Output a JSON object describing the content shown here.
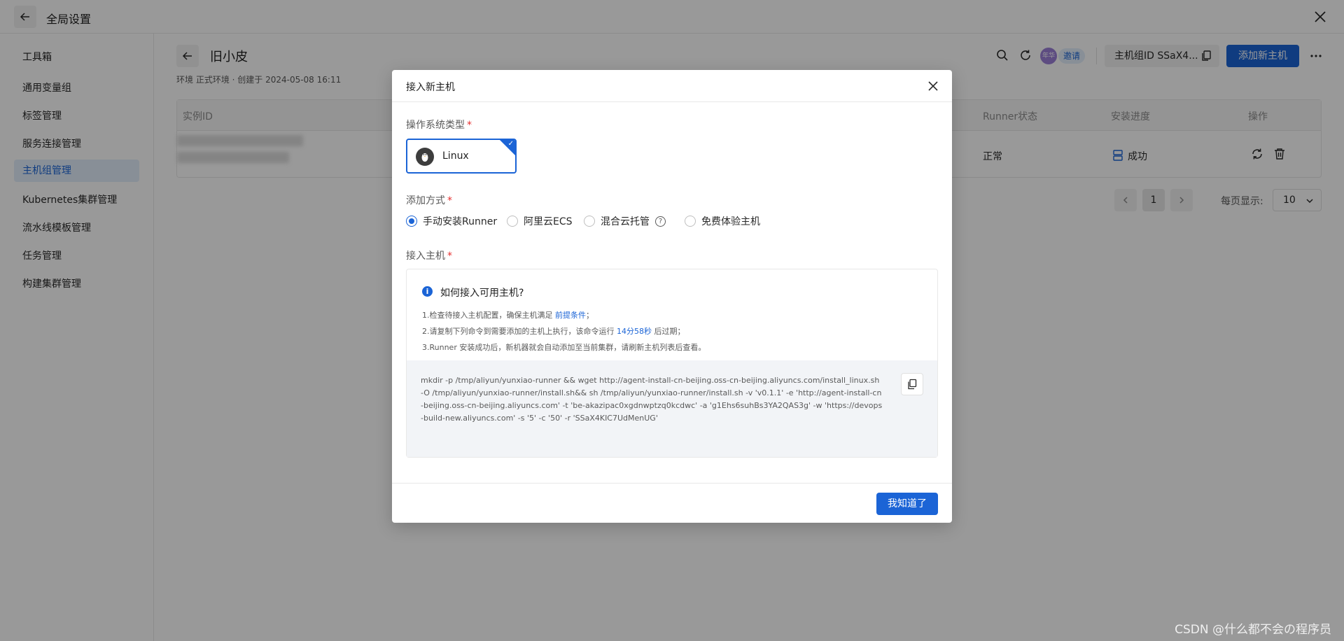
{
  "topbar": {
    "title": "全局设置"
  },
  "sidebar": {
    "heading": "工具箱",
    "items": [
      {
        "label": "通用变量组"
      },
      {
        "label": "标签管理"
      },
      {
        "label": "服务连接管理"
      },
      {
        "label": "主机组管理"
      },
      {
        "label": "Kubernetes集群管理"
      },
      {
        "label": "流水线模板管理"
      },
      {
        "label": "任务管理"
      },
      {
        "label": "构建集群管理"
      }
    ],
    "active_index": 3
  },
  "main": {
    "title": "旧小皮",
    "meta": "环境 正式环境 · 创建于 2024-05-08 16:11",
    "avatar_text": "年华",
    "invite_label": "邀请",
    "group_id_label": "主机组ID SSaX4...",
    "add_host_label": "添加新主机",
    "table": {
      "columns": [
        "实例ID",
        "Runner状态",
        "安装进度",
        "操作"
      ],
      "rows": [
        {
          "runner_status": "正常",
          "install_progress": "成功"
        }
      ]
    },
    "pagination": {
      "current_page": "1",
      "per_page_label": "每页显示:",
      "per_page_value": "10"
    }
  },
  "modal": {
    "title": "接入新主机",
    "os_label": "操作系统类型",
    "os_selected": "Linux",
    "method_label": "添加方式",
    "methods": [
      {
        "label": "手动安装Runner",
        "checked": true
      },
      {
        "label": "阿里云ECS",
        "checked": false
      },
      {
        "label": "混合云托管",
        "checked": false
      },
      {
        "label": "免费体验主机",
        "checked": false
      }
    ],
    "host_label": "接入主机",
    "info_title": "如何接入可用主机?",
    "step1_prefix": "1.检查待接入主机配置，确保主机满足",
    "step1_link": "前提条件",
    "step1_suffix": "；",
    "step2_prefix": "2.请复制下列命令到需要添加的主机上执行，该命令运行",
    "step2_time": "14分58秒",
    "step2_suffix": "后过期；",
    "step3": "3.Runner 安装成功后，新机器就会自动添加至当前集群，请刷新主机列表后查看。",
    "command": "mkdir -p /tmp/aliyun/yunxiao-runner && wget http://agent-install-cn-beijing.oss-cn-beijing.aliyuncs.com/install_linux.sh -O /tmp/aliyun/yunxiao-runner/install.sh&& sh /tmp/aliyun/yunxiao-runner/install.sh -v 'v0.1.1' -e 'http://agent-install-cn-beijing.oss-cn-beijing.aliyuncs.com' -t 'be-akazipac0xgdnwptzq0kcdwc' -a 'g1Ehs6suhBs3YA2QAS3g' -w 'https://devops-build-new.aliyuncs.com' -s '5' -c '50' -r 'SSaX4KIC7UdMenUG'",
    "ok_label": "我知道了"
  },
  "watermark": "CSDN @什么都不会の程序员",
  "colors": {
    "primary": "#1b64d6",
    "required": "#e62e2e",
    "overlay": "rgba(0,0,0,0.40)"
  }
}
